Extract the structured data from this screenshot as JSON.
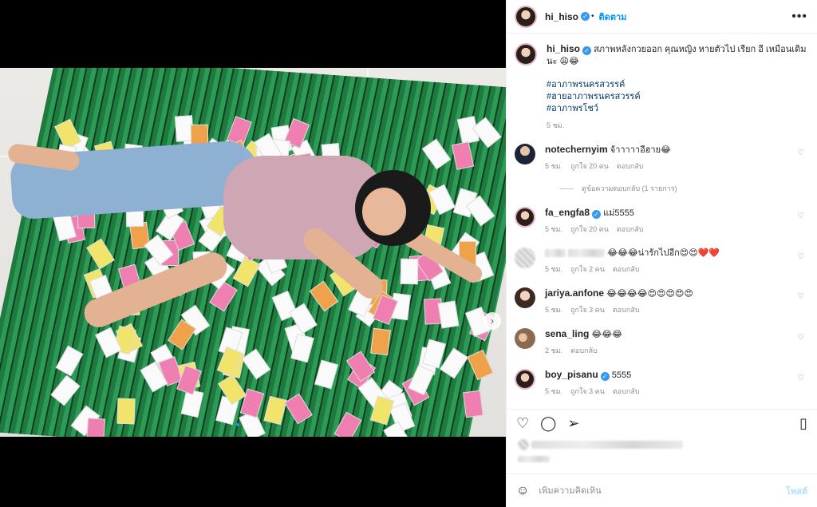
{
  "post": {
    "author": "hi_hiso",
    "follow_label": "ติดตาม",
    "more_icon": "more-icon",
    "caption": "สภาพหลังกวยออก คุณหญิง หายตัวไป เรียก อี เหมือนเดิมนะ 😩😂",
    "hashtags": [
      "#อาภาพรนครสวรรค์",
      "#ฮายอาภาพรนครสวรรค์",
      "#อาภาพรโชว์"
    ],
    "caption_time": "5 ชม."
  },
  "comments": [
    {
      "user": "notechernyim",
      "verified": false,
      "text": "จ้าาาาาอีฮาย😂",
      "time": "5 ชม.",
      "likes": "ถูกใจ 20 คน",
      "reply": "ตอบกลับ"
    },
    {
      "user": "fa_engfa8",
      "verified": true,
      "text": "แม่5555",
      "time": "5 ชม.",
      "likes": "ถูกใจ 20 คน",
      "reply": "ตอบกลับ"
    },
    {
      "user": "",
      "verified": false,
      "text": "😂😂😂น่ารักไปอีก😍😍❤️❤️",
      "time": "5 ชม.",
      "likes": "ถูกใจ 2 คน",
      "reply": "ตอบกลับ"
    },
    {
      "user": "jariya.anfone",
      "verified": false,
      "text": "😂😂😂😂😍😍😍😍😍",
      "time": "5 ชม.",
      "likes": "ถูกใจ 3 คน",
      "reply": "ตอบกลับ"
    },
    {
      "user": "sena_ling",
      "verified": false,
      "text": "😂😂😂",
      "time": "2 ชม.",
      "likes": "",
      "reply": "ตอบกลับ"
    },
    {
      "user": "boy_pisanu",
      "verified": true,
      "text": "5555",
      "time": "5 ชม.",
      "likes": "ถูกใจ 3 คน",
      "reply": "ตอบกลับ"
    }
  ],
  "view_replies": "ดูข้อความตอบกลับ (1 รายการ)",
  "compose": {
    "placeholder": "เพิ่มความคิดเห็น",
    "post_label": "โพสต์"
  },
  "colors": {
    "link": "#0095f6",
    "hashtag": "#00376b",
    "muted": "#8e8e8e",
    "verified": "#3897f0"
  },
  "carousel": {
    "slide_count": 3,
    "active_index": 0
  }
}
